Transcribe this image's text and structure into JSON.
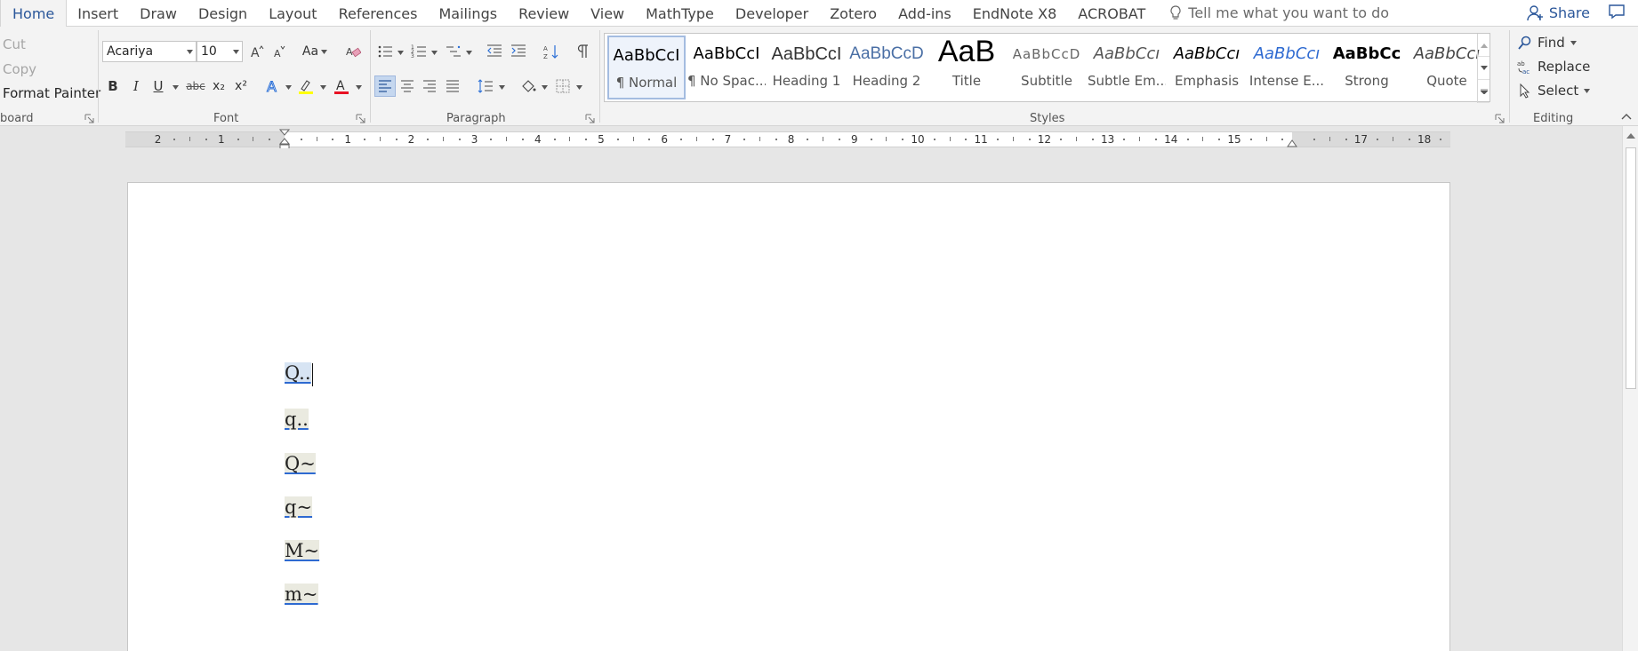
{
  "tabs": [
    {
      "label": "Home",
      "active": true
    },
    {
      "label": "Insert"
    },
    {
      "label": "Draw"
    },
    {
      "label": "Design"
    },
    {
      "label": "Layout"
    },
    {
      "label": "References"
    },
    {
      "label": "Mailings"
    },
    {
      "label": "Review"
    },
    {
      "label": "View"
    },
    {
      "label": "MathType"
    },
    {
      "label": "Developer"
    },
    {
      "label": "Zotero"
    },
    {
      "label": "Add-ins"
    },
    {
      "label": "EndNote X8"
    },
    {
      "label": "ACROBAT"
    }
  ],
  "tellme": {
    "placeholder": "Tell me what you want to do"
  },
  "share": {
    "label": "Share"
  },
  "clipboard": {
    "cut": "Cut",
    "copy": "Copy",
    "format_painter": "Format Painter",
    "label": "board"
  },
  "font": {
    "family": "Acariya",
    "size": "10",
    "case_label": "Aa",
    "label": "Font",
    "bold": "B",
    "italic": "I",
    "underline": "U",
    "strike": "abc",
    "subscript": "x₂",
    "superscript": "x²",
    "font_color": "#e81123",
    "highlight_color": "#ffff00"
  },
  "paragraph": {
    "label": "Paragraph"
  },
  "styles": {
    "label": "Styles",
    "items": [
      {
        "sample": "AaBbCcI",
        "name": "¶ Normal",
        "active": true
      },
      {
        "sample": "AaBbCcI",
        "name": "¶ No Spac..."
      },
      {
        "sample": "AaBbCcI",
        "name": "Heading 1"
      },
      {
        "sample": "AaBbCcD",
        "name": "Heading 2"
      },
      {
        "sample": "AaB",
        "name": "Title"
      },
      {
        "sample": "AaBbCcD",
        "name": "Subtitle"
      },
      {
        "sample": "AaBbCcı",
        "name": "Subtle Em..."
      },
      {
        "sample": "AaBbCcı",
        "name": "Emphasis"
      },
      {
        "sample": "AaBbCcı",
        "name": "Intense E..."
      },
      {
        "sample": "AaBbCc",
        "name": "Strong"
      },
      {
        "sample": "AaBbCcı",
        "name": "Quote"
      }
    ]
  },
  "editing": {
    "label": "Editing",
    "find": "Find",
    "replace": "Replace",
    "select": "Select"
  },
  "ruler": {
    "labels": [
      "2",
      "1",
      "1",
      "2",
      "3",
      "4",
      "5",
      "6",
      "7",
      "8",
      "9",
      "10",
      "11",
      "12",
      "13",
      "14",
      "15",
      "17",
      "18"
    ]
  },
  "document": {
    "paragraphs": [
      "Q..",
      "q..",
      "Q~",
      "q~",
      "M~",
      "m~"
    ]
  },
  "colors": {
    "accent": "#2b579a",
    "selection": "#c5d7ef"
  }
}
